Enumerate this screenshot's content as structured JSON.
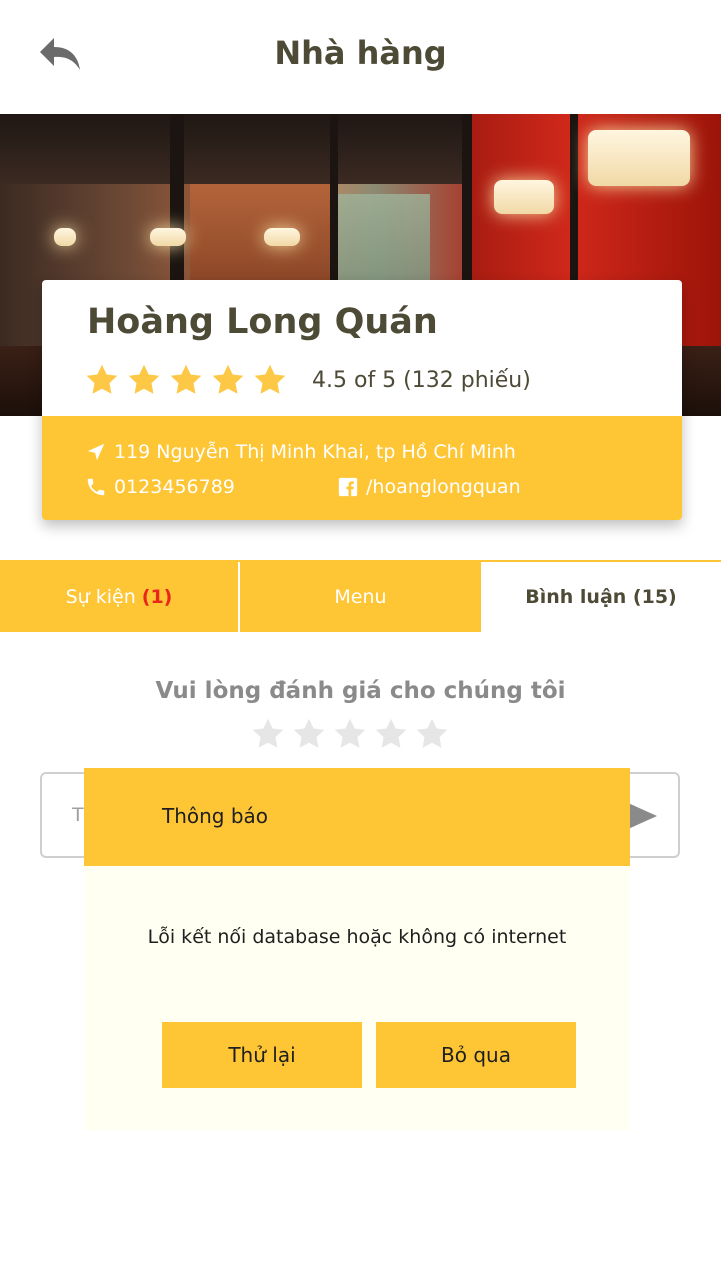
{
  "header": {
    "title": "Nhà hàng",
    "back_icon": "reply-arrow-icon"
  },
  "restaurant": {
    "name": "Hoàng Long Quán",
    "rating_stars": 5,
    "rating_text": "4.5 of 5 (132 phiếu)",
    "address": "119 Nguyễn Thị Minh Khai, tp Hồ Chí Minh",
    "phone": "0123456789",
    "facebook": "/hoanglongquan"
  },
  "tabs": [
    {
      "label": "Sự kiện",
      "count": "(1)"
    },
    {
      "label": "Menu"
    },
    {
      "label": "Bình luận (15)"
    }
  ],
  "review": {
    "prompt": "Vui lòng đánh giá cho chúng tôi",
    "stars": 5,
    "comment_placeholder": "T"
  },
  "dialog": {
    "title": "Thông báo",
    "message": "Lỗi kết nối database hoặc không có internet",
    "retry_label": "Thử lại",
    "skip_label": "Bỏ qua"
  },
  "colors": {
    "accent": "#fec534",
    "star_gold": "#fdc845",
    "star_gray": "#e6e6e6",
    "tab_count_red": "#e8261a",
    "dialog_bg": "#fffff2"
  }
}
